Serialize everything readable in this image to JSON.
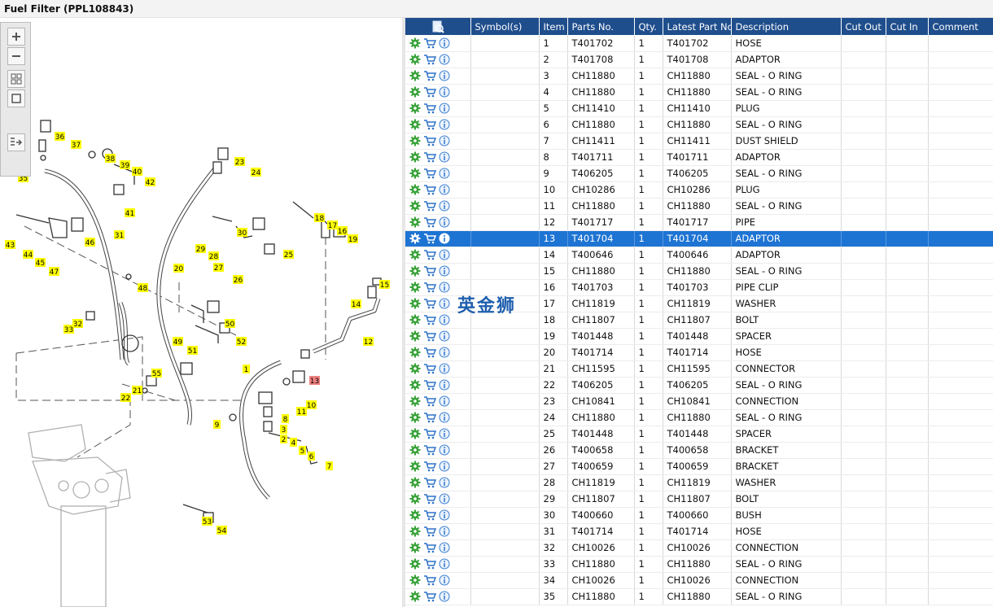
{
  "window": {
    "title": "Fuel Filter (PPL108843)"
  },
  "toolbar": {
    "items": [
      "zoom-in",
      "zoom-out",
      "fit-all",
      "actual-size",
      "export-list"
    ]
  },
  "diagram": {
    "callouts": [
      "1",
      "2",
      "3",
      "4",
      "5",
      "6",
      "7",
      "8",
      "9",
      "10",
      "11",
      "12",
      "13",
      "14",
      "15",
      "16",
      "17",
      "18",
      "19",
      "20",
      "21",
      "22",
      "23",
      "24",
      "25",
      "26",
      "27",
      "28",
      "29",
      "30",
      "31",
      "32",
      "33",
      "35",
      "36",
      "37",
      "38",
      "39",
      "40",
      "41",
      "42",
      "43",
      "44",
      "45",
      "46",
      "47",
      "48",
      "49",
      "50",
      "51",
      "52",
      "53",
      "54",
      "55"
    ],
    "highlighted_callout": "13",
    "colors": {
      "callout": "#ffff00",
      "highlight": "#f08080"
    }
  },
  "grid": {
    "columns": [
      "",
      "Symbol(s)",
      "Item",
      "Parts No.",
      "Qty.",
      "Latest Part No.",
      "Description",
      "Cut Out",
      "Cut In",
      "Comment"
    ],
    "selected_item": "13",
    "colors": {
      "header": "#1f4e8c",
      "selected": "#1e74d3"
    },
    "rows": [
      {
        "item": "1",
        "part": "T401702",
        "qty": "1",
        "latest": "T401702",
        "desc": "HOSE"
      },
      {
        "item": "2",
        "part": "T401708",
        "qty": "1",
        "latest": "T401708",
        "desc": "ADAPTOR"
      },
      {
        "item": "3",
        "part": "CH11880",
        "qty": "1",
        "latest": "CH11880",
        "desc": "SEAL - O RING"
      },
      {
        "item": "4",
        "part": "CH11880",
        "qty": "1",
        "latest": "CH11880",
        "desc": "SEAL - O RING"
      },
      {
        "item": "5",
        "part": "CH11410",
        "qty": "1",
        "latest": "CH11410",
        "desc": "PLUG"
      },
      {
        "item": "6",
        "part": "CH11880",
        "qty": "1",
        "latest": "CH11880",
        "desc": "SEAL - O RING"
      },
      {
        "item": "7",
        "part": "CH11411",
        "qty": "1",
        "latest": "CH11411",
        "desc": "DUST SHIELD"
      },
      {
        "item": "8",
        "part": "T401711",
        "qty": "1",
        "latest": "T401711",
        "desc": "ADAPTOR"
      },
      {
        "item": "9",
        "part": "T406205",
        "qty": "1",
        "latest": "T406205",
        "desc": "SEAL - O RING"
      },
      {
        "item": "10",
        "part": "CH10286",
        "qty": "1",
        "latest": "CH10286",
        "desc": "PLUG"
      },
      {
        "item": "11",
        "part": "CH11880",
        "qty": "1",
        "latest": "CH11880",
        "desc": "SEAL - O RING"
      },
      {
        "item": "12",
        "part": "T401717",
        "qty": "1",
        "latest": "T401717",
        "desc": "PIPE"
      },
      {
        "item": "13",
        "part": "T401704",
        "qty": "1",
        "latest": "T401704",
        "desc": "ADAPTOR"
      },
      {
        "item": "14",
        "part": "T400646",
        "qty": "1",
        "latest": "T400646",
        "desc": "ADAPTOR"
      },
      {
        "item": "15",
        "part": "CH11880",
        "qty": "1",
        "latest": "CH11880",
        "desc": "SEAL - O RING"
      },
      {
        "item": "16",
        "part": "T401703",
        "qty": "1",
        "latest": "T401703",
        "desc": "PIPE CLIP"
      },
      {
        "item": "17",
        "part": "CH11819",
        "qty": "1",
        "latest": "CH11819",
        "desc": "WASHER"
      },
      {
        "item": "18",
        "part": "CH11807",
        "qty": "1",
        "latest": "CH11807",
        "desc": "BOLT"
      },
      {
        "item": "19",
        "part": "T401448",
        "qty": "1",
        "latest": "T401448",
        "desc": "SPACER"
      },
      {
        "item": "20",
        "part": "T401714",
        "qty": "1",
        "latest": "T401714",
        "desc": "HOSE"
      },
      {
        "item": "21",
        "part": "CH11595",
        "qty": "1",
        "latest": "CH11595",
        "desc": "CONNECTOR"
      },
      {
        "item": "22",
        "part": "T406205",
        "qty": "1",
        "latest": "T406205",
        "desc": "SEAL - O RING"
      },
      {
        "item": "23",
        "part": "CH10841",
        "qty": "1",
        "latest": "CH10841",
        "desc": "CONNECTION"
      },
      {
        "item": "24",
        "part": "CH11880",
        "qty": "1",
        "latest": "CH11880",
        "desc": "SEAL - O RING"
      },
      {
        "item": "25",
        "part": "T401448",
        "qty": "1",
        "latest": "T401448",
        "desc": "SPACER"
      },
      {
        "item": "26",
        "part": "T400658",
        "qty": "1",
        "latest": "T400658",
        "desc": "BRACKET"
      },
      {
        "item": "27",
        "part": "T400659",
        "qty": "1",
        "latest": "T400659",
        "desc": "BRACKET"
      },
      {
        "item": "28",
        "part": "CH11819",
        "qty": "1",
        "latest": "CH11819",
        "desc": "WASHER"
      },
      {
        "item": "29",
        "part": "CH11807",
        "qty": "1",
        "latest": "CH11807",
        "desc": "BOLT"
      },
      {
        "item": "30",
        "part": "T400660",
        "qty": "1",
        "latest": "T400660",
        "desc": "BUSH"
      },
      {
        "item": "31",
        "part": "T401714",
        "qty": "1",
        "latest": "T401714",
        "desc": "HOSE"
      },
      {
        "item": "32",
        "part": "CH10026",
        "qty": "1",
        "latest": "CH10026",
        "desc": "CONNECTION"
      },
      {
        "item": "33",
        "part": "CH11880",
        "qty": "1",
        "latest": "CH11880",
        "desc": "SEAL - O RING"
      },
      {
        "item": "34",
        "part": "CH10026",
        "qty": "1",
        "latest": "CH10026",
        "desc": "CONNECTION"
      },
      {
        "item": "35",
        "part": "CH11880",
        "qty": "1",
        "latest": "CH11880",
        "desc": "SEAL - O RING"
      }
    ]
  },
  "watermark": "英金狮"
}
